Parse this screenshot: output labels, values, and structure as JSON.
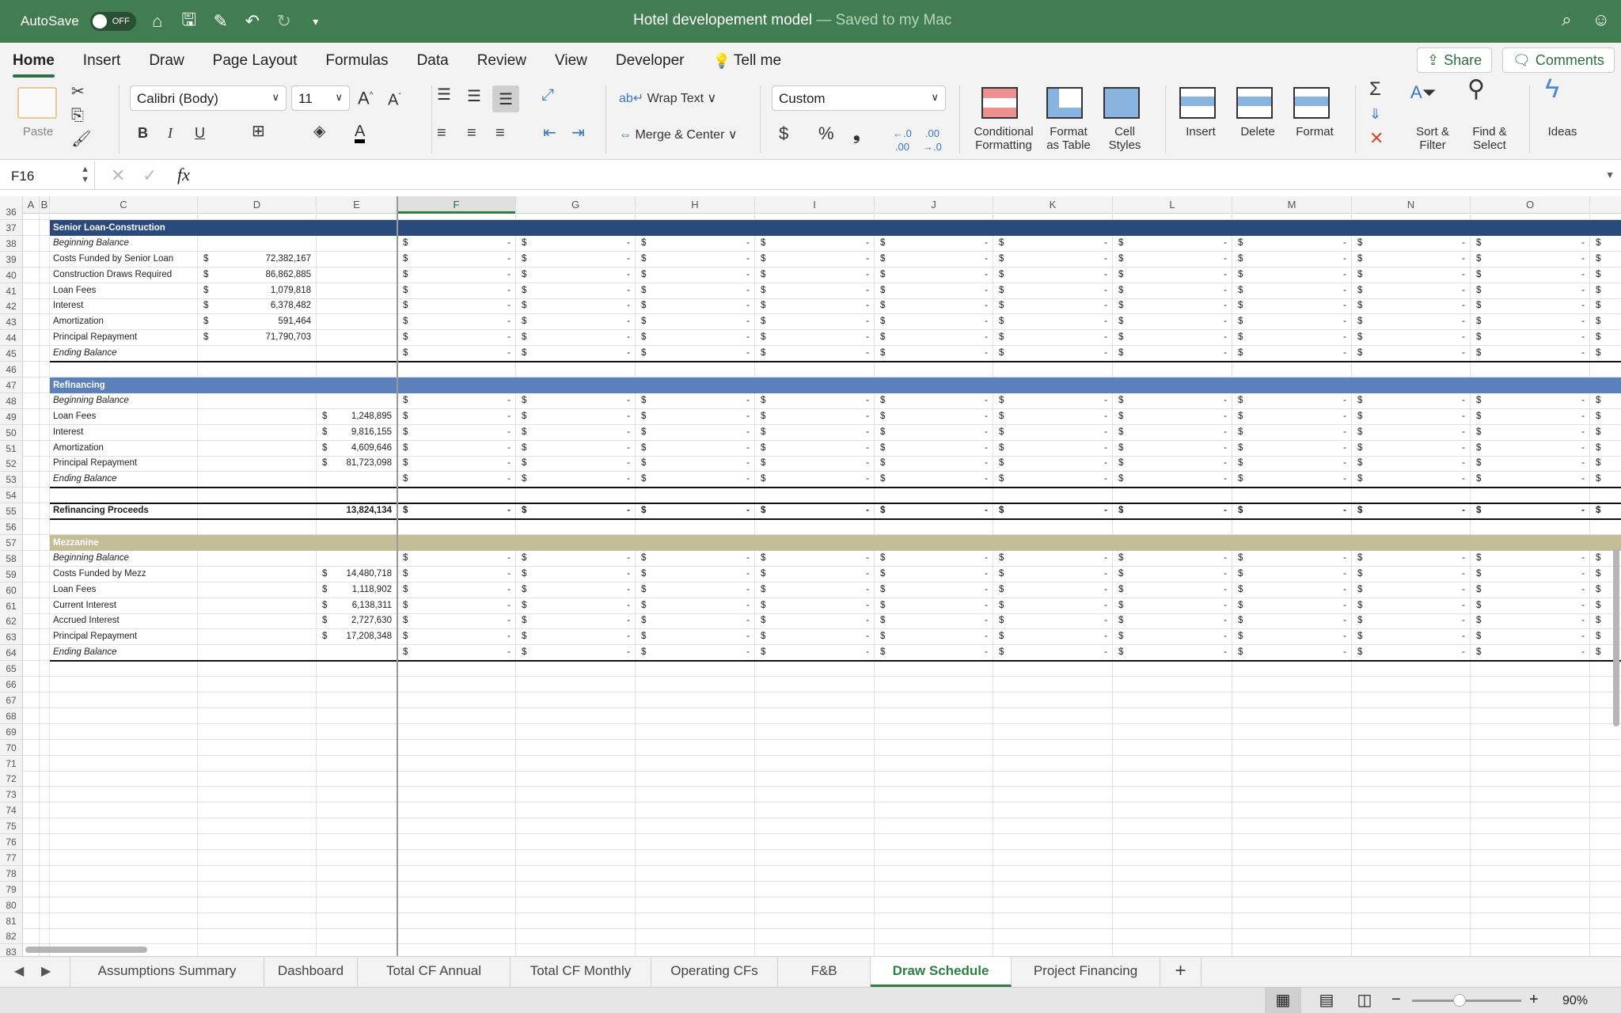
{
  "titlebar": {
    "autosave_label": "AutoSave",
    "autosave_state": "OFF",
    "doc_name": "Hotel developement model",
    "saved_status": "— Saved to my Mac"
  },
  "ribbon_tabs": [
    "Home",
    "Insert",
    "Draw",
    "Page Layout",
    "Formulas",
    "Data",
    "Review",
    "View",
    "Developer",
    "Tell me"
  ],
  "active_tab": "Home",
  "share_label": "Share",
  "comments_label": "Comments",
  "ribbon": {
    "paste": "Paste",
    "font_name": "Calibri (Body)",
    "font_size": "11",
    "bold": "B",
    "italic": "I",
    "underline": "U",
    "wrap_text": "Wrap Text",
    "merge_center": "Merge & Center",
    "number_format": "Custom",
    "currency": "$",
    "percent": "%",
    "comma": "❟",
    "conditional": "Conditional\nFormatting",
    "format_table": "Format\nas Table",
    "cell_styles": "Cell\nStyles",
    "insert": "Insert",
    "delete": "Delete",
    "format": "Format",
    "sort_filter": "Sort &\nFilter",
    "find_select": "Find &\nSelect",
    "ideas": "Ideas",
    "sigma": "Σ"
  },
  "formula_bar": {
    "name_box": "F16",
    "fx": "fx",
    "formula": ""
  },
  "sheet": {
    "columns": [
      "A",
      "B",
      "C",
      "D",
      "E",
      "F",
      "G",
      "H",
      "I",
      "J",
      "K",
      "L",
      "M",
      "N",
      "O",
      ""
    ],
    "active_column": "F",
    "empty_label": "$",
    "dash": "-",
    "rows": [
      {
        "num": "36",
        "type": "blank"
      },
      {
        "num": "37",
        "type": "hdr-senior",
        "label": "Senior Loan-Construction"
      },
      {
        "num": "38",
        "label": "Beginning Balance",
        "italic": true,
        "fill": true
      },
      {
        "num": "39",
        "label": "Costs Funded by Senior Loan",
        "d": "72,382,167",
        "fill": true
      },
      {
        "num": "40",
        "label": "Construction Draws Required",
        "d": "86,862,885",
        "fill": true
      },
      {
        "num": "41",
        "label": "Loan Fees",
        "d": "1,079,818",
        "fill": true
      },
      {
        "num": "42",
        "label": "Interest",
        "d": "6,378,482",
        "fill": true
      },
      {
        "num": "43",
        "label": "Amortization",
        "d": "591,464",
        "fill": true
      },
      {
        "num": "44",
        "label": "Principal Repayment",
        "d": "71,790,703",
        "fill": true
      },
      {
        "num": "45",
        "label": "Ending Balance",
        "italic": true,
        "fill": true,
        "bottom": true
      },
      {
        "num": "46",
        "type": "blank"
      },
      {
        "num": "47",
        "type": "hdr-refi",
        "label": "Refinancing"
      },
      {
        "num": "48",
        "label": "Beginning Balance",
        "italic": true,
        "fill": true
      },
      {
        "num": "49",
        "label": "Loan Fees",
        "e": "1,248,895",
        "fill": true
      },
      {
        "num": "50",
        "label": "Interest",
        "e": "9,816,155",
        "fill": true
      },
      {
        "num": "51",
        "label": "Amortization",
        "e": "4,609,646",
        "fill": true
      },
      {
        "num": "52",
        "label": "Principal Repayment",
        "e": "81,723,098",
        "fill": true
      },
      {
        "num": "53",
        "label": "Ending Balance",
        "italic": true,
        "fill": true,
        "bottom": true
      },
      {
        "num": "54",
        "type": "blank",
        "bottom": true
      },
      {
        "num": "55",
        "label": "Refinancing Proceeds",
        "e_plain": "13,824,134",
        "bold": true,
        "fill": true,
        "bottom": true
      },
      {
        "num": "56",
        "type": "blank"
      },
      {
        "num": "57",
        "type": "hdr-mezz",
        "label": "Mezzanine"
      },
      {
        "num": "58",
        "label": "Beginning Balance",
        "italic": true,
        "fill": true
      },
      {
        "num": "59",
        "label": "Costs Funded by Mezz",
        "e": "14,480,718",
        "fill": true
      },
      {
        "num": "60",
        "label": "Loan Fees",
        "e": "1,118,902",
        "fill": true
      },
      {
        "num": "61",
        "label": "Current Interest",
        "e": "6,138,311",
        "fill": true
      },
      {
        "num": "62",
        "label": "Accrued Interest",
        "e": "2,727,630",
        "fill": true
      },
      {
        "num": "63",
        "label": "Principal Repayment",
        "e": "17,208,348",
        "fill": true
      },
      {
        "num": "64",
        "label": "Ending Balance",
        "italic": true,
        "fill": true,
        "bottom": true
      },
      {
        "num": "65",
        "type": "blank"
      },
      {
        "num": "66",
        "type": "blank"
      },
      {
        "num": "67",
        "type": "blank"
      },
      {
        "num": "68",
        "type": "blank"
      },
      {
        "num": "69",
        "type": "blank"
      },
      {
        "num": "70",
        "type": "blank"
      },
      {
        "num": "71",
        "type": "blank"
      },
      {
        "num": "72",
        "type": "blank"
      },
      {
        "num": "73",
        "type": "blank"
      },
      {
        "num": "74",
        "type": "blank"
      },
      {
        "num": "75",
        "type": "blank"
      },
      {
        "num": "76",
        "type": "blank"
      },
      {
        "num": "77",
        "type": "blank"
      },
      {
        "num": "78",
        "type": "blank"
      },
      {
        "num": "79",
        "type": "blank"
      },
      {
        "num": "80",
        "type": "blank"
      },
      {
        "num": "81",
        "type": "blank"
      },
      {
        "num": "82",
        "type": "blank"
      },
      {
        "num": "83",
        "type": "blank"
      }
    ]
  },
  "sheet_tabs": [
    "Assumptions Summary",
    "Dashboard",
    "Total CF Annual",
    "Total CF Monthly",
    "Operating CFs",
    "F&B",
    "Draw Schedule",
    "Project Financing"
  ],
  "active_sheet": "Draw Schedule",
  "add_sheet": "+",
  "status": {
    "zoom": "90%",
    "minus": "−",
    "plus": "+"
  },
  "colors": {
    "title_green": "#427d51",
    "senior_header": "#2a4a7c",
    "refinancing_header": "#5b80ba",
    "mezzanine_header": "#c4bd98"
  }
}
